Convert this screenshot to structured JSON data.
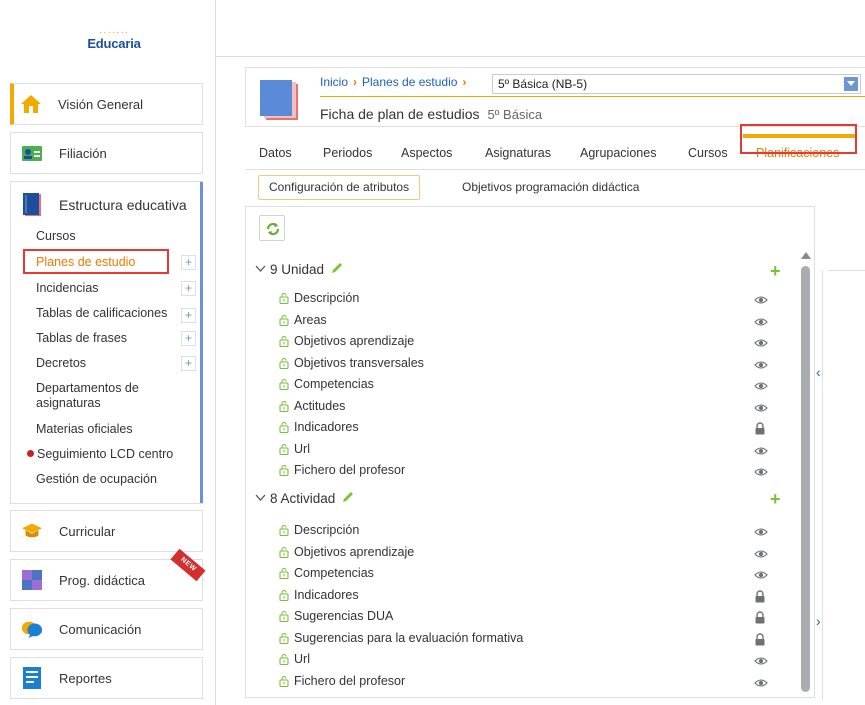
{
  "app": {
    "logo_text": "Educaria",
    "logo_dots": "·······"
  },
  "sidebar": {
    "vision": "Visión General",
    "filiacion": "Filiación",
    "estructura": {
      "title": "Estructura educativa",
      "items": [
        {
          "label": "Cursos"
        },
        {
          "label": "Planes de estudio"
        },
        {
          "label": "Incidencias"
        },
        {
          "label": "Tablas de calificaciones"
        },
        {
          "label": "Tablas de frases"
        },
        {
          "label": "Decretos"
        },
        {
          "label": "Departamentos de asignaturas"
        },
        {
          "label": "Materias oficiales"
        },
        {
          "label": "Seguimiento LCD centro"
        },
        {
          "label": "Gestión de ocupación"
        }
      ]
    },
    "curricular": "Curricular",
    "prog": "Prog. didáctica",
    "new_badge": "NEW",
    "comunicacion": "Comunicación",
    "reportes": "Reportes",
    "plus": "+"
  },
  "breadcrumb": {
    "inicio": "Inicio",
    "planes": "Planes de estudio"
  },
  "plan_select": {
    "value": "5º Básica (NB-5)"
  },
  "page": {
    "title": "Ficha de plan de estudios",
    "subtitle": "5º Básica"
  },
  "tabs": [
    "Datos",
    "Periodos",
    "Aspectos",
    "Asignaturas",
    "Agrupaciones",
    "Cursos",
    "Planificaciones"
  ],
  "subtabs": {
    "config": "Configuración de atributos",
    "objetivos": "Objetivos programación didáctica"
  },
  "groups": [
    {
      "title": "9 Unidad",
      "fields": [
        {
          "label": "Descripción",
          "state": "visible"
        },
        {
          "label": "Areas",
          "state": "visible"
        },
        {
          "label": "Objetivos aprendizaje",
          "state": "visible"
        },
        {
          "label": "Objetivos transversales",
          "state": "visible"
        },
        {
          "label": "Competencias",
          "state": "visible"
        },
        {
          "label": "Actitudes",
          "state": "visible"
        },
        {
          "label": "Indicadores",
          "state": "locked"
        },
        {
          "label": "Url",
          "state": "visible"
        },
        {
          "label": "Fichero del profesor",
          "state": "visible"
        }
      ]
    },
    {
      "title": "8 Actividad",
      "fields": [
        {
          "label": "Descripción",
          "state": "visible"
        },
        {
          "label": "Objetivos aprendizaje",
          "state": "visible"
        },
        {
          "label": "Competencias",
          "state": "visible"
        },
        {
          "label": "Indicadores",
          "state": "locked"
        },
        {
          "label": "Sugerencias DUA",
          "state": "locked"
        },
        {
          "label": "Sugerencias para la evaluación formativa",
          "state": "locked"
        },
        {
          "label": "Url",
          "state": "visible"
        },
        {
          "label": "Fichero del profesor",
          "state": "visible"
        }
      ]
    }
  ],
  "icons": {
    "chevron": "chevron-down-icon",
    "pencil": "pencil-icon",
    "add": "plus-icon",
    "field": "unlock-icon",
    "visible": "eye-icon",
    "locked": "lock-icon",
    "refresh": "refresh-icon"
  },
  "colors": {
    "accent": "#f27a00",
    "link": "#1f5fbf",
    "highlight": "#e53935",
    "green": "#7bbf3a",
    "brand": "#1b4f9c"
  }
}
